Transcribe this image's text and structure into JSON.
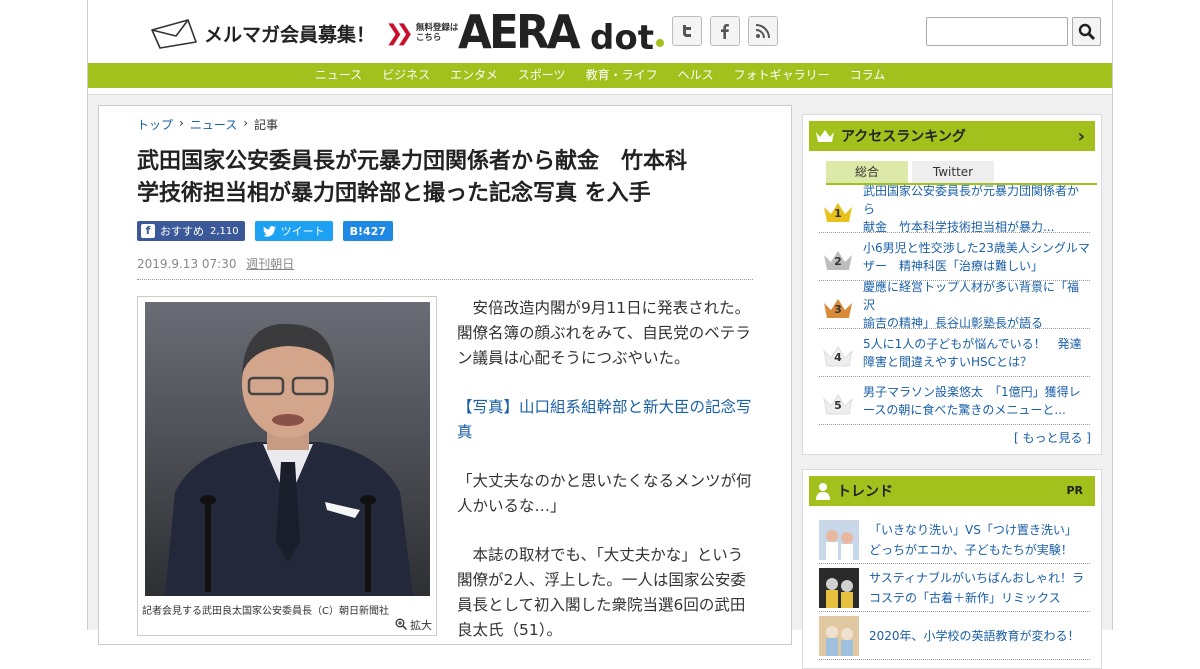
{
  "header": {
    "mailmag_label": "メルマガ会員募集！",
    "mailmag_sub_1": "無料登録は",
    "mailmag_sub_2": "こちら",
    "logo_main": "AERA",
    "logo_dot": "dot",
    "social": [
      "t",
      "f",
      "rss"
    ],
    "search_placeholder": ""
  },
  "nav": [
    "ニュース",
    "ビジネス",
    "エンタメ",
    "スポーツ",
    "教育・ライフ",
    "ヘルス",
    "フォトギャラリー",
    "コラム"
  ],
  "breadcrumb": {
    "home": "トップ",
    "section": "ニュース",
    "current": "記事"
  },
  "article": {
    "title_line1": "武田国家公安委員長が元暴力団関係者から献金　竹本科",
    "title_line2": "学技術担当相が暴力団幹部と撮った記念写真 を入手",
    "share": {
      "fb_label": "おすすめ",
      "fb_count": "2,110",
      "tw_label": "ツイート",
      "hb_label": "B!",
      "hb_count": "427"
    },
    "date": "2019.9.13 07:30",
    "source": "週刊朝日",
    "caption": "記者会見する武田良太国家公安委員長（C）朝日新聞社",
    "zoom_label": "拡大",
    "para1": "安倍改造内閣が9月11日に発表された。閣僚名簿の顔ぶれをみて、自民党のベテラン議員は心配そうにつぶやいた。",
    "link1": "【写真】山口組系組幹部と新大臣の記念写真",
    "para2": "「大丈夫なのかと思いたくなるメンツが何人かいるな…」",
    "para3": "本誌の取材でも、「大丈夫かな」という閣僚が2人、浮上した。一人は国家公安委員長として初入閣した衆院当選6回の武田良太氏（51）。"
  },
  "ranking": {
    "title": "アクセスランキング",
    "tabs": [
      "総合",
      "Twitter"
    ],
    "items": [
      {
        "rank": "1",
        "text1": "武田国家公安委員長が元暴力団関係者から",
        "text2": "献金　竹本科学技術担当相が暴力..."
      },
      {
        "rank": "2",
        "text1": "小6男児と性交渉した23歳美人シングルマ",
        "text2": "ザー　精神科医「治療は難しい」"
      },
      {
        "rank": "3",
        "text1": "慶應に経営トップ人材が多い背景に「福沢",
        "text2": "諭吉の精神」長谷山彰塾長が語る"
      },
      {
        "rank": "4",
        "text1": "5人に1人の子どもが悩んでいる！　発達",
        "text2": "障害と間違えやすいHSCとは？"
      },
      {
        "rank": "5",
        "text1": "男子マラソン設楽悠太　「1億円」獲得レ",
        "text2": "ースの朝に食べた驚きのメニューと..."
      }
    ],
    "more": "[ もっと見る ]",
    "crown_colors": {
      "gold": "#e8c21c",
      "silver": "#bdbdbd",
      "bronze": "#d98a3a"
    }
  },
  "trend": {
    "title": "トレンド",
    "pr": "PR",
    "items": [
      {
        "text1": "「いきなり洗い」VS「つけ置き洗い」",
        "text2": "どっちがエコか、子どもたちが実験！"
      },
      {
        "text1": "サスティナブルがいちばんおしゃれ！ラ",
        "text2": "コステの「古着＋新作」リミックス"
      },
      {
        "text1": "2020年、小学校の英語教育が変わる！",
        "text2": ""
      }
    ]
  },
  "colors": {
    "accent": "#a2c11c",
    "link": "#1a5fa8",
    "fb": "#3b5998",
    "tw": "#1da1f2",
    "hb": "#1e88e5"
  }
}
